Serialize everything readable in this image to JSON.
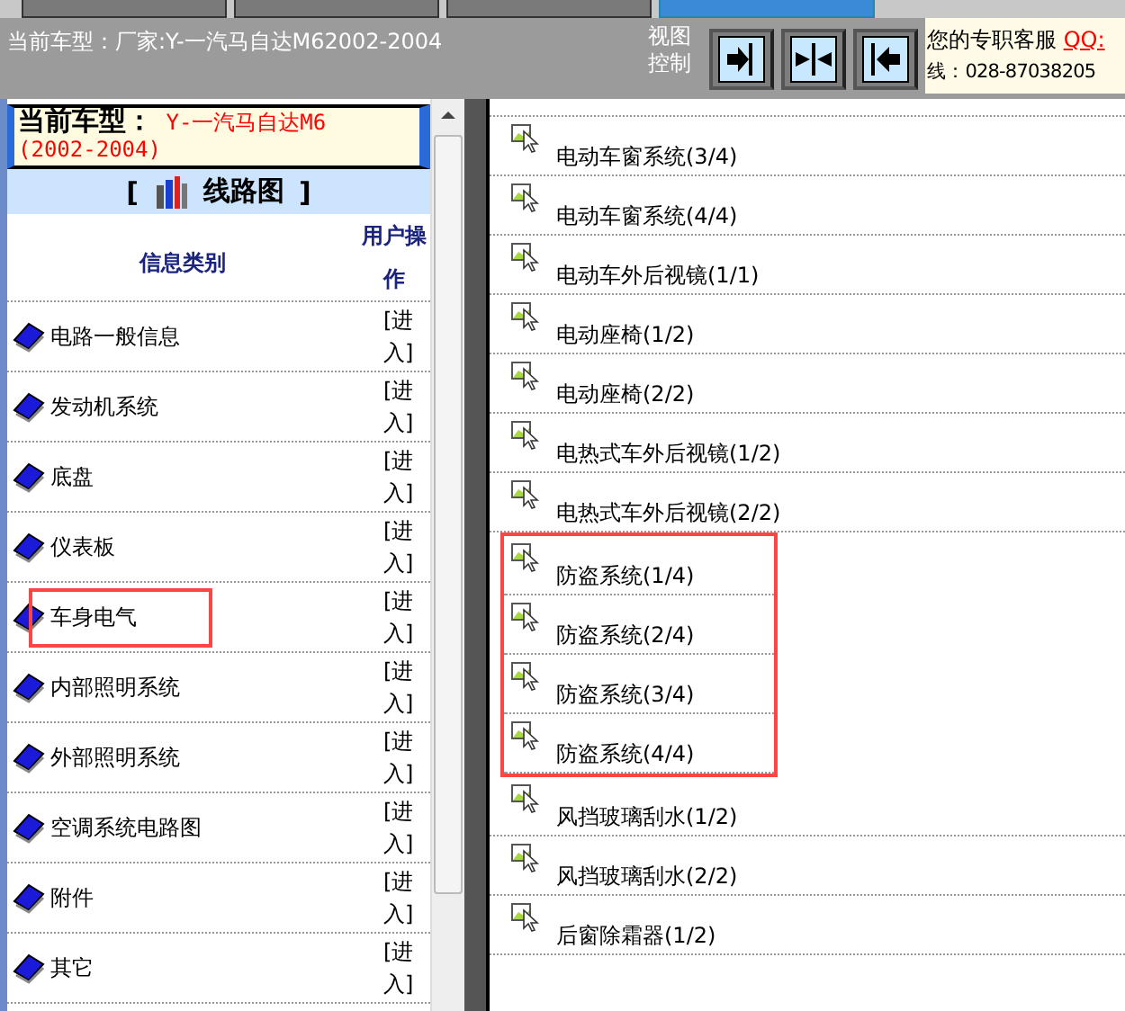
{
  "toolbar_tabs": [
    {
      "selected": false
    },
    {
      "selected": false
    },
    {
      "selected": false
    },
    {
      "selected": true
    }
  ],
  "header": {
    "model_label": "当前车型：厂家:Y-一汽马自达M62002-2004",
    "view_control_label": "视图控制",
    "view_buttons": [
      {
        "kind": "right"
      },
      {
        "kind": "both"
      },
      {
        "kind": "left"
      }
    ],
    "contact": {
      "text": "您的专职客服",
      "link": "QQ:",
      "phone": "线：028-87038205"
    }
  },
  "left_panel": {
    "model_title": "当前车型：",
    "model_name": "Y-一汽马自达M6",
    "model_years": "(2002-2004)",
    "section_open": "[",
    "section_title": "线路图",
    "section_close": "]",
    "columns": [
      "信息类别",
      "用户操作"
    ],
    "rows": [
      {
        "label": "电路一般信息",
        "action": "[进入]",
        "highlighted": false
      },
      {
        "label": "发动机系统",
        "action": "[进入]",
        "highlighted": false
      },
      {
        "label": "底盘",
        "action": "[进入]",
        "highlighted": false
      },
      {
        "label": "仪表板",
        "action": "[进入]",
        "highlighted": false
      },
      {
        "label": "车身电气",
        "action": "[进入]",
        "highlighted": true
      },
      {
        "label": "内部照明系统",
        "action": "[进入]",
        "highlighted": false
      },
      {
        "label": "外部照明系统",
        "action": "[进入]",
        "highlighted": false
      },
      {
        "label": "空调系统电路图",
        "action": "[进入]",
        "highlighted": false
      },
      {
        "label": "附件",
        "action": "[进入]",
        "highlighted": false
      },
      {
        "label": "其它",
        "action": "[进入]",
        "highlighted": false
      }
    ]
  },
  "diagram_list": {
    "items": [
      {
        "label": "电动车窗系统(3/4)",
        "highlighted": false
      },
      {
        "label": "电动车窗系统(4/4)",
        "highlighted": false
      },
      {
        "label": "电动车外后视镜(1/1)",
        "highlighted": false
      },
      {
        "label": "电动座椅(1/2)",
        "highlighted": false
      },
      {
        "label": "电动座椅(2/2)",
        "highlighted": false
      },
      {
        "label": "电热式车外后视镜(1/2)",
        "highlighted": false
      },
      {
        "label": "电热式车外后视镜(2/2)",
        "highlighted": false
      },
      {
        "label": "防盗系统(1/4)",
        "highlighted": true
      },
      {
        "label": "防盗系统(2/4)",
        "highlighted": true
      },
      {
        "label": "防盗系统(3/4)",
        "highlighted": true
      },
      {
        "label": "防盗系统(4/4)",
        "highlighted": true
      },
      {
        "label": "风挡玻璃刮水(1/2)",
        "highlighted": false
      },
      {
        "label": "风挡玻璃刮水(2/2)",
        "highlighted": false
      },
      {
        "label": "后窗除霜器(1/2)",
        "highlighted": false
      }
    ]
  }
}
